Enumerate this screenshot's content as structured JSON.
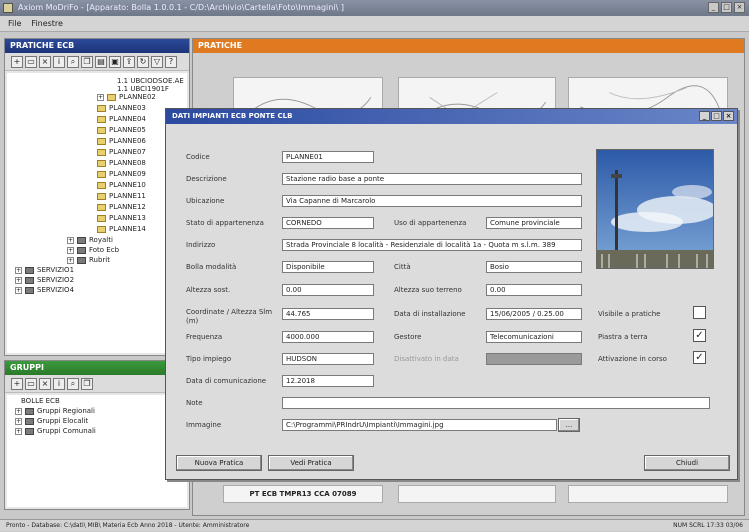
{
  "window": {
    "title": "Axiom MoDriFo - [Apparato: Bolla 1.0.0.1 - C/D:\\Archivio\\Cartella\\Foto\\Immagini\\ ]",
    "controls": [
      "_",
      "□",
      "×"
    ]
  },
  "menu": [
    "File",
    "Finestre"
  ],
  "left_top_panel": {
    "title": "PRATICHE ECB",
    "tree": [
      {
        "label": "1.1   UBCIODSOE.AE",
        "type": "text"
      },
      {
        "label": "1.1   UBCI1901F",
        "type": "text"
      },
      {
        "label": "PLANNE02",
        "type": "folder"
      },
      {
        "label": "PLANNE03",
        "type": "folder"
      },
      {
        "label": "PLANNE04",
        "type": "folder"
      },
      {
        "label": "PLANNE05",
        "type": "folder"
      },
      {
        "label": "PLANNE06",
        "type": "folder"
      },
      {
        "label": "PLANNE07",
        "type": "folder"
      },
      {
        "label": "PLANNE08",
        "type": "folder"
      },
      {
        "label": "PLANNE09",
        "type": "folder"
      },
      {
        "label": "PLANNE10",
        "type": "folder"
      },
      {
        "label": "PLANNE11",
        "type": "folder"
      },
      {
        "label": "PLANNE12",
        "type": "folder"
      },
      {
        "label": "PLANNE13",
        "type": "folder"
      },
      {
        "label": "PLANNE14",
        "type": "folder"
      },
      {
        "label": "Royalti",
        "type": "box"
      },
      {
        "label": "Foto Ecb",
        "type": "box"
      },
      {
        "label": "Rubrit",
        "type": "box"
      },
      {
        "label": "SERVIZIO1",
        "type": "box"
      },
      {
        "label": "SERVIZIO2",
        "type": "box"
      },
      {
        "label": "SERVIZIO4",
        "type": "box"
      }
    ]
  },
  "left_bottom_panel": {
    "title": "GRUPPI",
    "tree": [
      {
        "label": "BOLLE ECB",
        "type": "text"
      },
      {
        "label": "Gruppi Regionali",
        "type": "box"
      },
      {
        "label": "Gruppi Elocalit",
        "type": "box"
      },
      {
        "label": "Gruppi Comunali",
        "type": "box"
      }
    ]
  },
  "main_panel": {
    "title": "PRATICHE",
    "footer_field": "PT ECB TMPR13 CCA 07089"
  },
  "dialog": {
    "title": "DATI IMPIANTI ECB PONTE CLB",
    "fields": {
      "codice": {
        "label": "Codice",
        "value": "PLANNE01"
      },
      "descrizione": {
        "label": "Descrizione",
        "value": "Stazione radio base a ponte"
      },
      "ubicazione": {
        "label": "Ubicazione",
        "value": "Via Capanne di Marcarolo"
      },
      "stato_appartenenza": {
        "label": "Stato di appartenenza",
        "value": "CORNEDO"
      },
      "uso_appartenenza": {
        "label": "Uso di appartenenza",
        "value": "Comune provinciale"
      },
      "indirizzo": {
        "label": "Indirizzo",
        "value": "Strada Provinciale 8 località - Residenziale di località 1a - Quota m s.l.m. 389"
      },
      "bolla_modalita": {
        "label": "Bolla modalità",
        "value": "Disponibile"
      },
      "citta": {
        "label": "Città",
        "value": "Bosio"
      },
      "altezza_sost": {
        "label": "Altezza sost.",
        "value": "0.00"
      },
      "altezza_suo_terreno": {
        "label": "Altezza suo terreno",
        "value": "0.00"
      },
      "coordinate": {
        "label": "Coordinate / Altezza Slm (m)",
        "value": "44.765"
      },
      "data_installazione": {
        "label": "Data di installazione",
        "value": "15/06/2005 / 0.25.00"
      },
      "frequenza": {
        "label": "Frequenza",
        "value": "4000.000"
      },
      "gestore": {
        "label": "Gestore",
        "value": "Telecomunicazioni"
      },
      "tipo_impiego": {
        "label": "Tipo impiego",
        "value": "HUDSON"
      },
      "disattivato": {
        "label": "Disattivato in data",
        "value": ""
      },
      "data_comunicazione": {
        "label": "Data di comunicazione",
        "value": "12.2018"
      },
      "note": {
        "label": "Note",
        "value": ""
      },
      "immagine": {
        "label": "Immagine",
        "value": "C:\\Programmi\\PRIndrU\\Impianti\\Immagini.jpg"
      }
    },
    "checkboxes": [
      {
        "label": "Visibile a pratiche",
        "checked": false
      },
      {
        "label": "Piastra a terra",
        "checked": true
      },
      {
        "label": "Attivazione in corso",
        "checked": true
      }
    ],
    "buttons": {
      "new": "Nuova Pratica",
      "edit": "Vedi Pratica",
      "close": "Chiudi",
      "browse": "..."
    }
  },
  "statusbar": {
    "left": "Pronto - Database: C:\\dati\\ MIB\\ Materia Ecb Anno 2018 - Utente: Amministratore",
    "right": "NUM  SCRL  17:33  03/06"
  }
}
